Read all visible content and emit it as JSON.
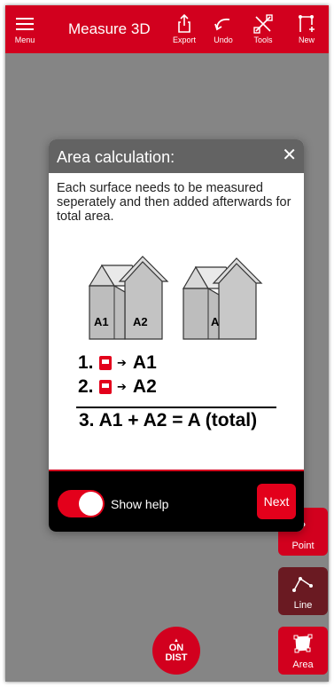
{
  "toolbar": {
    "menu_label": "Menu",
    "title": "Measure 3D",
    "export_label": "Export",
    "undo_label": "Undo",
    "tools_label": "Tools",
    "new_label": "New"
  },
  "side_tools": {
    "point_label": "Point",
    "line_label": "Line",
    "area_label": "Area"
  },
  "onoff": {
    "top": "ON",
    "bottom": "DIST"
  },
  "dialog": {
    "title": "Area calculation:",
    "close_glyph": "✕",
    "description": "Each surface needs to be measured seperately and then added afterwards for total area.",
    "illustration_labels": {
      "left_a1": "A1",
      "left_a2": "A2",
      "right_a": "A"
    },
    "steps": [
      {
        "num": "1.",
        "arrow": "➔",
        "target": "A1"
      },
      {
        "num": "2.",
        "arrow": "➔",
        "target": "A2"
      }
    ],
    "total_line": "3.  A1 + A2 = A (total)",
    "show_help_label": "Show help",
    "show_help_on": true,
    "next_label": "Next"
  },
  "colors": {
    "accent": "#d2001e",
    "dialog_header": "#636363",
    "background": "#8c8c8c"
  }
}
